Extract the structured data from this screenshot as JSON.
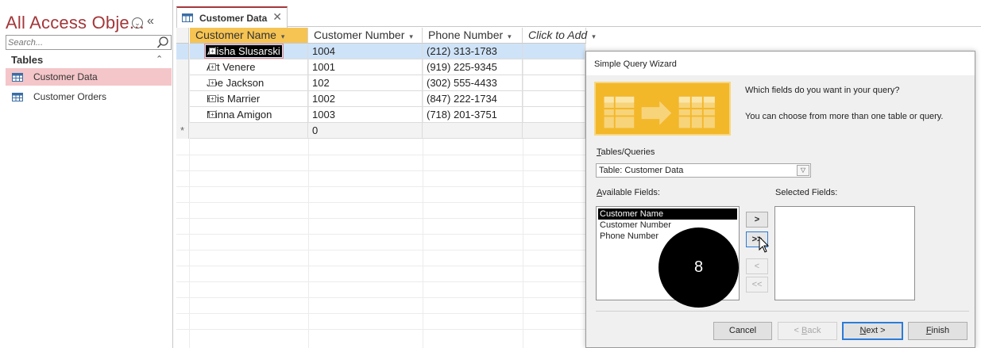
{
  "nav": {
    "title": "All Access Obje...",
    "search_placeholder": "Search...",
    "group_label": "Tables",
    "items": [
      {
        "label": "Customer Data",
        "selected": true
      },
      {
        "label": "Customer Orders",
        "selected": false
      }
    ]
  },
  "tab": {
    "label": "Customer Data"
  },
  "columns": [
    {
      "label": "Customer Name"
    },
    {
      "label": "Customer Number"
    },
    {
      "label": "Phone Number"
    },
    {
      "label": "Click to Add"
    }
  ],
  "rows": [
    {
      "name": "Alisha Slusarski",
      "number": "1004",
      "phone": "(212) 313-1783"
    },
    {
      "name": "Art Venere",
      "number": "1001",
      "phone": "(919) 225-9345"
    },
    {
      "name": "Joe Jackson",
      "number": "102",
      "phone": "(302) 555-4433"
    },
    {
      "name": "Kris Marrier",
      "number": "1002",
      "phone": "(847) 222-1734"
    },
    {
      "name": "Minna Amigon",
      "number": "1003",
      "phone": "(718) 201-3751"
    }
  ],
  "new_row": {
    "marker": "*",
    "number": "0"
  },
  "wizard": {
    "title": "Simple Query Wizard",
    "question": "Which fields do you want in your query?",
    "hint": "You can choose from more than one table or query.",
    "tables_queries_label": "Tables/Queries",
    "tables_queries_value": "Table: Customer Data",
    "available_label": "Available Fields:",
    "selected_label": "Selected Fields:",
    "available_fields": [
      "Customer Name",
      "Customer Number",
      "Phone Number"
    ],
    "move_buttons": [
      ">",
      ">>",
      "<",
      "<<"
    ],
    "buttons": {
      "cancel": "Cancel",
      "back": "< Back",
      "next": "Next >",
      "finish": "Finish"
    }
  },
  "step_badge": "8",
  "colors": {
    "accent": "#a4373a",
    "selection": "#f4c6c9",
    "wizard_graphic": "#f3b72a"
  }
}
